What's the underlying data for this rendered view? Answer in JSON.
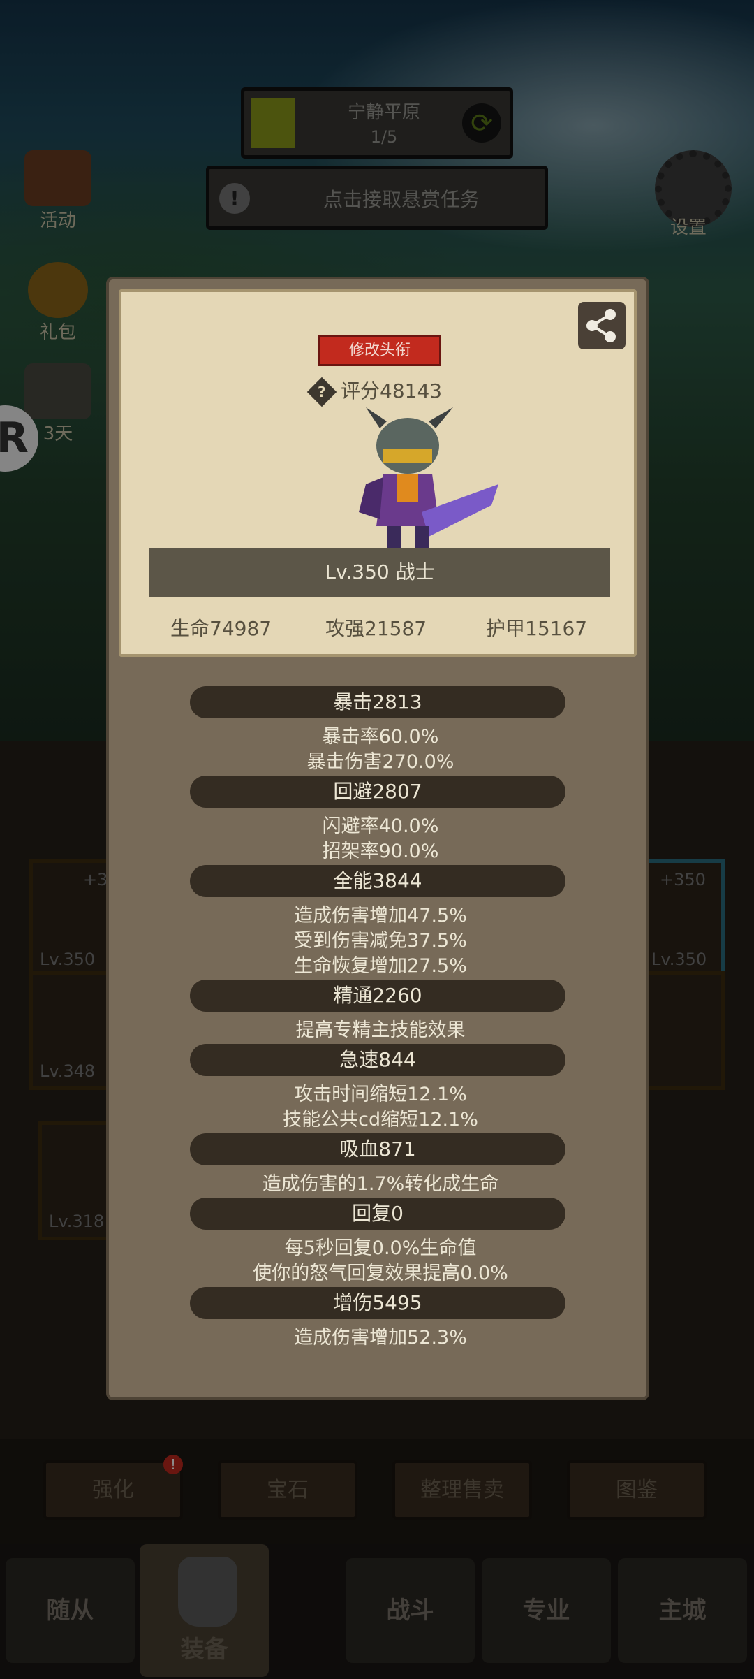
{
  "top": {
    "stage_name": "宁静平原",
    "stage_progress": "1/5",
    "bounty_text": "点击接取悬赏任务"
  },
  "side": {
    "activity": "活动",
    "gift": "礼包",
    "trial": "3天",
    "settings": "设置"
  },
  "background_slots": [
    {
      "level": "Lv.350",
      "bonus": "+3"
    },
    {
      "level": "Lv.348"
    },
    {
      "level": "Lv.318"
    },
    {
      "level": "Lv.350",
      "bonus": "+350"
    }
  ],
  "actions": {
    "strengthen": "强化",
    "gem": "宝石",
    "sort_sell": "整理售卖",
    "codex": "图鉴"
  },
  "nav": {
    "followers": "随从",
    "equipment": "装备",
    "battle": "战斗",
    "profession": "专业",
    "main_city": "主城"
  },
  "profile": {
    "change_title": "修改头衔",
    "score": "评分48143",
    "level_class": "Lv.350 战士",
    "hp": "生命74987",
    "attack": "攻强21587",
    "armor": "护甲15167"
  },
  "stats": [
    {
      "header": "暴击2813",
      "lines": [
        "暴击率60.0%",
        "暴击伤害270.0%"
      ]
    },
    {
      "header": "回避2807",
      "lines": [
        "闪避率40.0%",
        "招架率90.0%"
      ]
    },
    {
      "header": "全能3844",
      "lines": [
        "造成伤害增加47.5%",
        "受到伤害减免37.5%",
        "生命恢复增加27.5%"
      ]
    },
    {
      "header": "精通2260",
      "lines": [
        "提高专精主技能效果"
      ]
    },
    {
      "header": "急速844",
      "lines": [
        "攻击时间缩短12.1%",
        "技能公共cd缩短12.1%"
      ]
    },
    {
      "header": "吸血871",
      "lines": [
        "造成伤害的1.7%转化成生命"
      ]
    },
    {
      "header": "回复0",
      "lines": [
        "每5秒回复0.0%生命值",
        "使你的怒气回复效果提高0.0%"
      ]
    },
    {
      "header": "增伤5495",
      "lines": [
        "造成伤害增加52.3%"
      ]
    }
  ]
}
